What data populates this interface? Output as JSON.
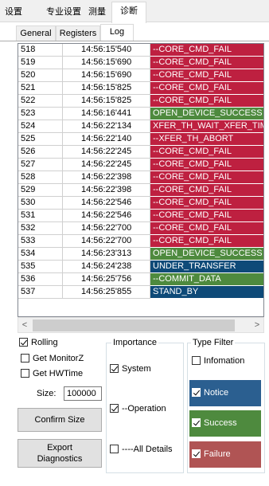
{
  "top_tabs": [
    {
      "label": "设置"
    },
    {
      "label": "专业设置"
    },
    {
      "label": "测量"
    },
    {
      "label": "诊断",
      "active": true
    }
  ],
  "sub_tabs": [
    {
      "label": "General"
    },
    {
      "label": "Registers"
    },
    {
      "label": "Log",
      "active": true
    }
  ],
  "colors": {
    "failure": "#be2040",
    "success": "#4e8a3e",
    "notice": "#0e4a78",
    "failure_tile": "#b05454",
    "success_tile": "#4e8a3e",
    "notice_tile": "#2b5f90"
  },
  "log": [
    {
      "id": "518",
      "time": "14:56:15'540",
      "msg": "--CORE_CMD_FAIL",
      "type": "failure"
    },
    {
      "id": "519",
      "time": "14:56:15'690",
      "msg": "--CORE_CMD_FAIL",
      "type": "failure"
    },
    {
      "id": "520",
      "time": "14:56:15'690",
      "msg": "--CORE_CMD_FAIL",
      "type": "failure"
    },
    {
      "id": "521",
      "time": "14:56:15'825",
      "msg": "--CORE_CMD_FAIL",
      "type": "failure"
    },
    {
      "id": "522",
      "time": "14:56:15'825",
      "msg": "--CORE_CMD_FAIL",
      "type": "failure"
    },
    {
      "id": "523",
      "time": "14:56:16'441",
      "msg": "OPEN_DEVICE_SUCCESS",
      "type": "success"
    },
    {
      "id": "524",
      "time": "14:56:22'134",
      "msg": "XFER_TH_WAIT_XFER_TIMEOUT",
      "type": "failure"
    },
    {
      "id": "525",
      "time": "14:56:22'140",
      "msg": "--XFER_TH_ABORT",
      "type": "failure"
    },
    {
      "id": "526",
      "time": "14:56:22'245",
      "msg": "--CORE_CMD_FAIL",
      "type": "failure"
    },
    {
      "id": "527",
      "time": "14:56:22'245",
      "msg": "--CORE_CMD_FAIL",
      "type": "failure"
    },
    {
      "id": "528",
      "time": "14:56:22'398",
      "msg": "--CORE_CMD_FAIL",
      "type": "failure"
    },
    {
      "id": "529",
      "time": "14:56:22'398",
      "msg": "--CORE_CMD_FAIL",
      "type": "failure"
    },
    {
      "id": "530",
      "time": "14:56:22'546",
      "msg": "--CORE_CMD_FAIL",
      "type": "failure"
    },
    {
      "id": "531",
      "time": "14:56:22'546",
      "msg": "--CORE_CMD_FAIL",
      "type": "failure"
    },
    {
      "id": "532",
      "time": "14:56:22'700",
      "msg": "--CORE_CMD_FAIL",
      "type": "failure"
    },
    {
      "id": "533",
      "time": "14:56:22'700",
      "msg": "--CORE_CMD_FAIL",
      "type": "failure"
    },
    {
      "id": "534",
      "time": "14:56:23'313",
      "msg": "OPEN_DEVICE_SUCCESS",
      "type": "success"
    },
    {
      "id": "535",
      "time": "14:56:24'238",
      "msg": "UNDER_TRANSFER",
      "type": "notice"
    },
    {
      "id": "536",
      "time": "14:56:25'756",
      "msg": "--COMMIT_DATA",
      "type": "success"
    },
    {
      "id": "537",
      "time": "14:56:25'855",
      "msg": "STAND_BY",
      "type": "notice"
    }
  ],
  "scrollbar": {
    "left_arrow": "<",
    "right_arrow": ">"
  },
  "controls": {
    "rolling": {
      "label": "Rolling",
      "checked": true
    },
    "get_monitorz": {
      "label": "Get MonitorZ",
      "checked": false
    },
    "get_hwtime": {
      "label": "Get HWTime",
      "checked": false
    },
    "size_label": "Size:",
    "size_value": "100000",
    "confirm_size_label": "Confirm Size",
    "export_label_line1": "Export",
    "export_label_line2": "Diagnostics"
  },
  "importance": {
    "title": "Importance",
    "system": {
      "label": "System",
      "checked": true
    },
    "operation": {
      "label": "--Operation",
      "checked": true
    },
    "all_details": {
      "label": "----All Details",
      "checked": false
    }
  },
  "type_filter": {
    "title": "Type Filter",
    "information": {
      "label": "Infomation",
      "checked": false
    },
    "notice": {
      "label": "Notice",
      "checked": true
    },
    "success": {
      "label": "Success",
      "checked": true
    },
    "failure": {
      "label": "Failure",
      "checked": true
    }
  }
}
